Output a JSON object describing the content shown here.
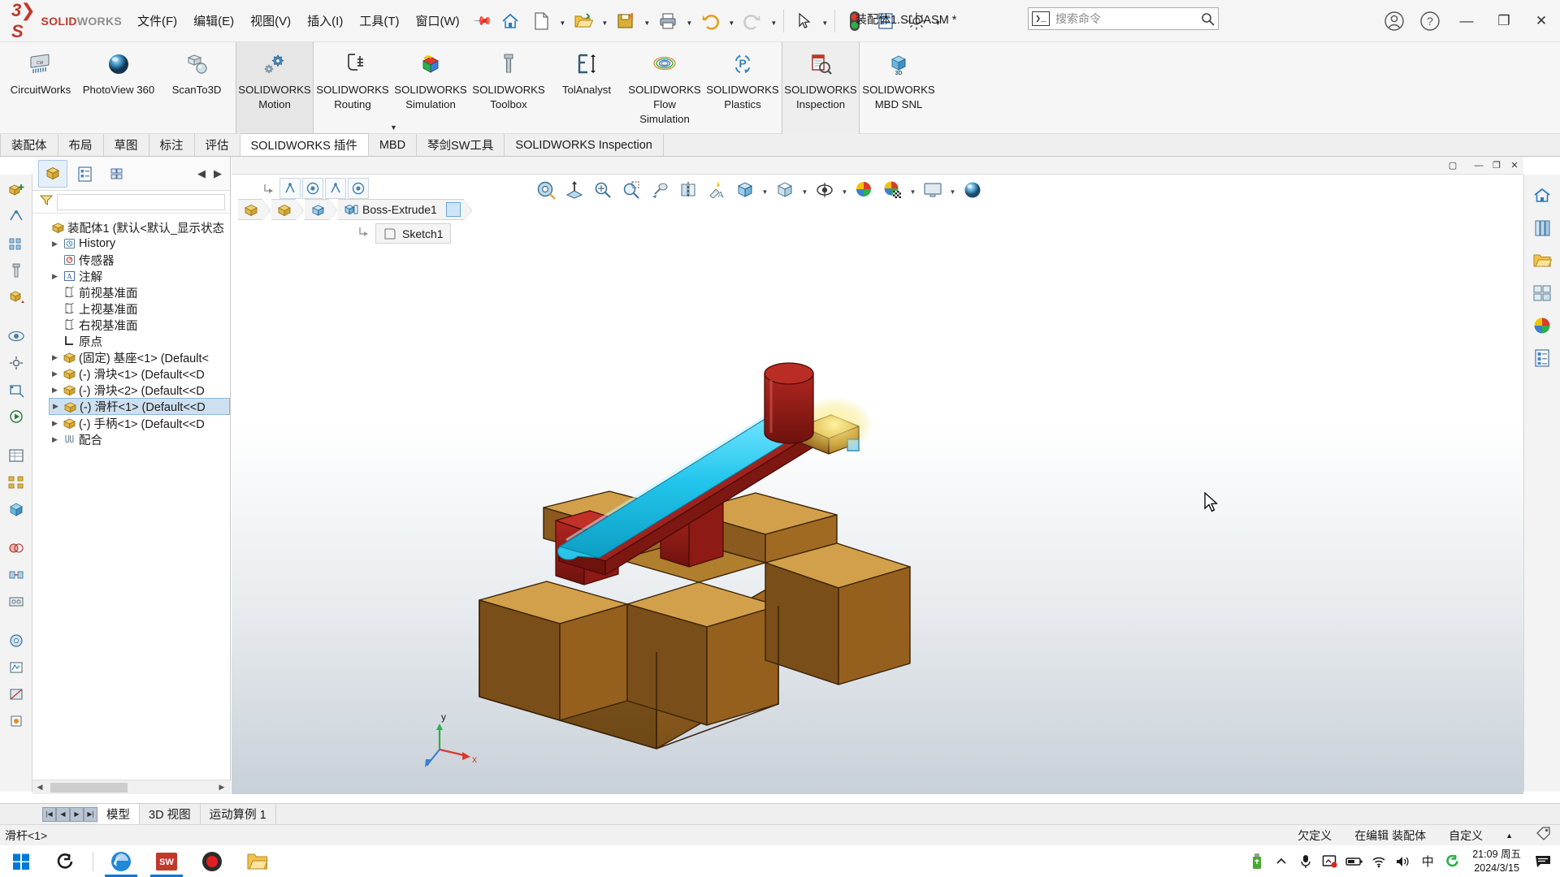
{
  "app": {
    "brand_ds": "3DS",
    "brand_bold": "SOLID",
    "brand_light": "WORKS",
    "document_title": "装配体1.SLDASM *"
  },
  "menubar": {
    "items": [
      {
        "label": "文件(F)",
        "name": "menu-file"
      },
      {
        "label": "编辑(E)",
        "name": "menu-edit"
      },
      {
        "label": "视图(V)",
        "name": "menu-view"
      },
      {
        "label": "插入(I)",
        "name": "menu-insert"
      },
      {
        "label": "工具(T)",
        "name": "menu-tools"
      },
      {
        "label": "窗口(W)",
        "name": "menu-window"
      }
    ],
    "pin_icon": "pin-icon"
  },
  "quickbar": {
    "buttons": [
      {
        "name": "home-icon"
      },
      {
        "name": "new-document-icon"
      },
      {
        "name": "open-document-icon"
      },
      {
        "name": "save-icon"
      },
      {
        "name": "print-icon"
      },
      {
        "name": "undo-icon"
      },
      {
        "name": "redo-icon"
      },
      {
        "name": "select-icon"
      },
      {
        "name": "rebuild-icon"
      },
      {
        "name": "file-properties-icon"
      },
      {
        "name": "options-icon"
      }
    ]
  },
  "search": {
    "placeholder": "搜索命令",
    "icon": "command-search-icon"
  },
  "window_controls": {
    "account": "user-account-icon",
    "help": "help-icon",
    "minimize": "—",
    "maximize": "❐",
    "close": "✕"
  },
  "ribbon": {
    "items": [
      {
        "label": "CircuitWorks",
        "icon": "circuitworks-icon",
        "state": "normal"
      },
      {
        "label": "PhotoView 360",
        "icon": "photoview360-icon",
        "state": "normal"
      },
      {
        "label": "ScanTo3D",
        "icon": "scanto3d-icon",
        "state": "normal"
      },
      {
        "label": "SOLIDWORKS Motion",
        "icon": "solidworks-motion-icon",
        "state": "active"
      },
      {
        "label": "SOLIDWORKS Routing",
        "icon": "solidworks-routing-icon",
        "state": "normal"
      },
      {
        "label": "SOLIDWORKS Simulation",
        "icon": "solidworks-simulation-icon",
        "state": "normal"
      },
      {
        "label": "SOLIDWORKS Toolbox",
        "icon": "solidworks-toolbox-icon",
        "state": "normal"
      },
      {
        "label": "TolAnalyst",
        "icon": "tolanalyst-icon",
        "state": "normal"
      },
      {
        "label": "SOLIDWORKS Flow Simulation",
        "icon": "solidworks-flow-simulation-icon",
        "state": "normal"
      },
      {
        "label": "SOLIDWORKS Plastics",
        "icon": "solidworks-plastics-icon",
        "state": "normal"
      },
      {
        "label": "SOLIDWORKS Inspection",
        "icon": "solidworks-inspection-icon",
        "state": "active2"
      },
      {
        "label": "SOLIDWORKS MBD SNL",
        "icon": "solidworks-mbd-snl-icon",
        "state": "normal"
      }
    ]
  },
  "cad_tabs": {
    "items": [
      {
        "label": "装配体",
        "selected": false
      },
      {
        "label": "布局",
        "selected": false
      },
      {
        "label": "草图",
        "selected": false
      },
      {
        "label": "标注",
        "selected": false
      },
      {
        "label": "评估",
        "selected": false
      },
      {
        "label": "SOLIDWORKS 插件",
        "selected": true
      },
      {
        "label": "MBD",
        "selected": false
      },
      {
        "label": "琴剑SW工具",
        "selected": false
      },
      {
        "label": "SOLIDWORKS Inspection",
        "selected": false
      }
    ]
  },
  "feature_manager": {
    "tabs": [
      {
        "name": "feature-tree-tab",
        "selected": true
      },
      {
        "name": "property-manager-tab",
        "selected": false
      },
      {
        "name": "configuration-manager-tab",
        "selected": false
      },
      {
        "name": "display-manager-tab",
        "selected": false
      }
    ],
    "filter_placeholder": "",
    "tree": [
      {
        "indent": 0,
        "arrow": "",
        "icon": "assembly-icon",
        "label": "装配体1  (默认<默认_显示状态",
        "selected": false
      },
      {
        "indent": 1,
        "arrow": "▶",
        "icon": "history-icon",
        "label": "History",
        "selected": false
      },
      {
        "indent": 1,
        "arrow": "",
        "icon": "sensor-icon",
        "label": "传感器",
        "selected": false
      },
      {
        "indent": 1,
        "arrow": "▶",
        "icon": "annotation-icon",
        "label": "注解",
        "selected": false
      },
      {
        "indent": 1,
        "arrow": "",
        "icon": "plane-icon",
        "label": "前视基准面",
        "selected": false
      },
      {
        "indent": 1,
        "arrow": "",
        "icon": "plane-icon",
        "label": "上视基准面",
        "selected": false
      },
      {
        "indent": 1,
        "arrow": "",
        "icon": "plane-icon",
        "label": "右视基准面",
        "selected": false
      },
      {
        "indent": 1,
        "arrow": "",
        "icon": "origin-icon",
        "label": "原点",
        "selected": false
      },
      {
        "indent": 1,
        "arrow": "▶",
        "icon": "component-icon",
        "label": "(固定) 基座<1> (Default<",
        "selected": false
      },
      {
        "indent": 1,
        "arrow": "▶",
        "icon": "component-icon",
        "label": "(-) 滑块<1> (Default<<D",
        "selected": false
      },
      {
        "indent": 1,
        "arrow": "▶",
        "icon": "component-icon",
        "label": "(-) 滑块<2> (Default<<D",
        "selected": false
      },
      {
        "indent": 1,
        "arrow": "▶",
        "icon": "component-icon",
        "label": "(-) 滑杆<1> (Default<<D",
        "selected": true
      },
      {
        "indent": 1,
        "arrow": "▶",
        "icon": "component-icon",
        "label": "(-) 手柄<1> (Default<<D",
        "selected": false
      },
      {
        "indent": 1,
        "arrow": "▶",
        "icon": "mates-icon",
        "label": "配合",
        "selected": false
      }
    ]
  },
  "breadcrumb": {
    "chips": [
      {
        "icon": "assembly-icon"
      },
      {
        "icon": "subassembly-icon"
      },
      {
        "icon": "part-icon"
      },
      {
        "icon": "feature-icon",
        "label": "Boss-Extrude1"
      }
    ],
    "sketch_label": "Sketch1",
    "sketch_arrow_icon": "child-arrow-icon"
  },
  "context_toolbar": {
    "buttons": [
      {
        "name": "coincident-mate-icon"
      },
      {
        "name": "concentric-mate-icon"
      },
      {
        "name": "coincident-mate-icon-2"
      },
      {
        "name": "concentric-mate-icon-2"
      },
      {
        "name": "parallel-mate-icon"
      },
      {
        "name": "lock-mate-icon"
      }
    ],
    "prefix_icon": "flyout-arrow-icon"
  },
  "view_toolbar": {
    "buttons": [
      {
        "name": "measure-icon",
        "caret": false
      },
      {
        "name": "section-view-icon",
        "caret": false
      },
      {
        "name": "zoom-to-fit-icon",
        "caret": false
      },
      {
        "name": "zoom-to-area-icon",
        "caret": false
      },
      {
        "name": "view-orientation-icon",
        "caret": false
      },
      {
        "name": "mirror-icon",
        "caret": false
      },
      {
        "name": "apply-scene-lighting-icon",
        "caret": false
      },
      {
        "name": "display-style-icon",
        "caret": true
      },
      {
        "name": "view-orientation-cube-icon",
        "caret": true
      },
      {
        "name": "hide-show-items-icon",
        "caret": true
      },
      {
        "name": "appearances-icon",
        "caret": false
      },
      {
        "name": "scene-icon",
        "caret": true
      },
      {
        "name": "view-settings-icon",
        "caret": true
      },
      {
        "name": "realview-icon",
        "caret": false
      }
    ]
  },
  "task_pane": {
    "items": [
      {
        "name": "sw-resources-icon"
      },
      {
        "name": "design-library-icon"
      },
      {
        "name": "file-explorer-icon"
      },
      {
        "name": "view-palette-icon"
      },
      {
        "name": "appearances-scenes-icon"
      },
      {
        "name": "custom-properties-icon"
      }
    ]
  },
  "left_rail": {
    "items": [
      {
        "name": "assembly-insert-component-icon"
      },
      {
        "name": "mate-icon"
      },
      {
        "name": "linear-pattern-icon"
      },
      {
        "name": "smart-fasteners-icon"
      },
      {
        "name": "move-component-icon"
      },
      {
        "name": "show-hidden-icon"
      },
      {
        "name": "assembly-features-icon"
      },
      {
        "name": "reference-geometry-icon"
      },
      {
        "name": "new-motion-study-icon"
      },
      {
        "name": "bill-of-materials-icon"
      },
      {
        "name": "exploded-view-icon"
      },
      {
        "name": "instant3d-icon"
      },
      {
        "name": "interference-detection-icon"
      },
      {
        "name": "clearance-verification-icon"
      },
      {
        "name": "hole-alignment-icon"
      },
      {
        "name": "measure-tool-icon"
      },
      {
        "name": "mass-properties-icon"
      },
      {
        "name": "section-properties-icon"
      },
      {
        "name": "sensor-tool-icon"
      }
    ]
  },
  "model_tabs": {
    "nav_buttons": [
      "|◀",
      "◀",
      "▶",
      "▶|"
    ],
    "items": [
      {
        "label": "模型",
        "selected": true
      },
      {
        "label": "3D 视图",
        "selected": false
      },
      {
        "label": "运动算例 1",
        "selected": false
      }
    ]
  },
  "status_bar": {
    "left": "滑杆<1>",
    "items": [
      {
        "label": "欠定义",
        "name": "status-underdefined"
      },
      {
        "label": "在编辑 装配体",
        "name": "status-editing-assembly"
      },
      {
        "label": "自定义",
        "name": "status-custom"
      }
    ],
    "caret": "▲",
    "tag_icon": "tag-icon"
  },
  "taskbar": {
    "start_icon": "windows-start-icon",
    "apps": [
      {
        "name": "taskbar-app-sogou",
        "label": "S"
      },
      {
        "name": "taskbar-app-edge",
        "label": "e"
      },
      {
        "name": "taskbar-app-solidworks",
        "label": "SW",
        "running": true
      },
      {
        "name": "taskbar-app-recorder",
        "label": "●"
      },
      {
        "name": "taskbar-app-explorer",
        "label": "📁"
      }
    ],
    "tray": [
      {
        "name": "usb-drive-icon"
      },
      {
        "name": "show-hidden-icons-chevron"
      },
      {
        "name": "microphone-icon"
      },
      {
        "name": "screen-capture-icon"
      },
      {
        "name": "battery-icon"
      },
      {
        "name": "wifi-icon"
      },
      {
        "name": "volume-icon"
      },
      {
        "name": "ime-chinese-icon"
      },
      {
        "name": "sogou-input-icon"
      }
    ],
    "clock_time": "21:09 周五",
    "clock_date": "2024/3/15",
    "notification_icon": "notification-icon"
  },
  "colors": {
    "accent": "#c0392b",
    "selection": "#cde0f2",
    "highlight_cyan": "#29c4e8",
    "base_brown": "#8a5a1e",
    "base_tan": "#c99a3e",
    "red_part": "#9b1b1b",
    "taskbar_blue": "#0078d7"
  }
}
